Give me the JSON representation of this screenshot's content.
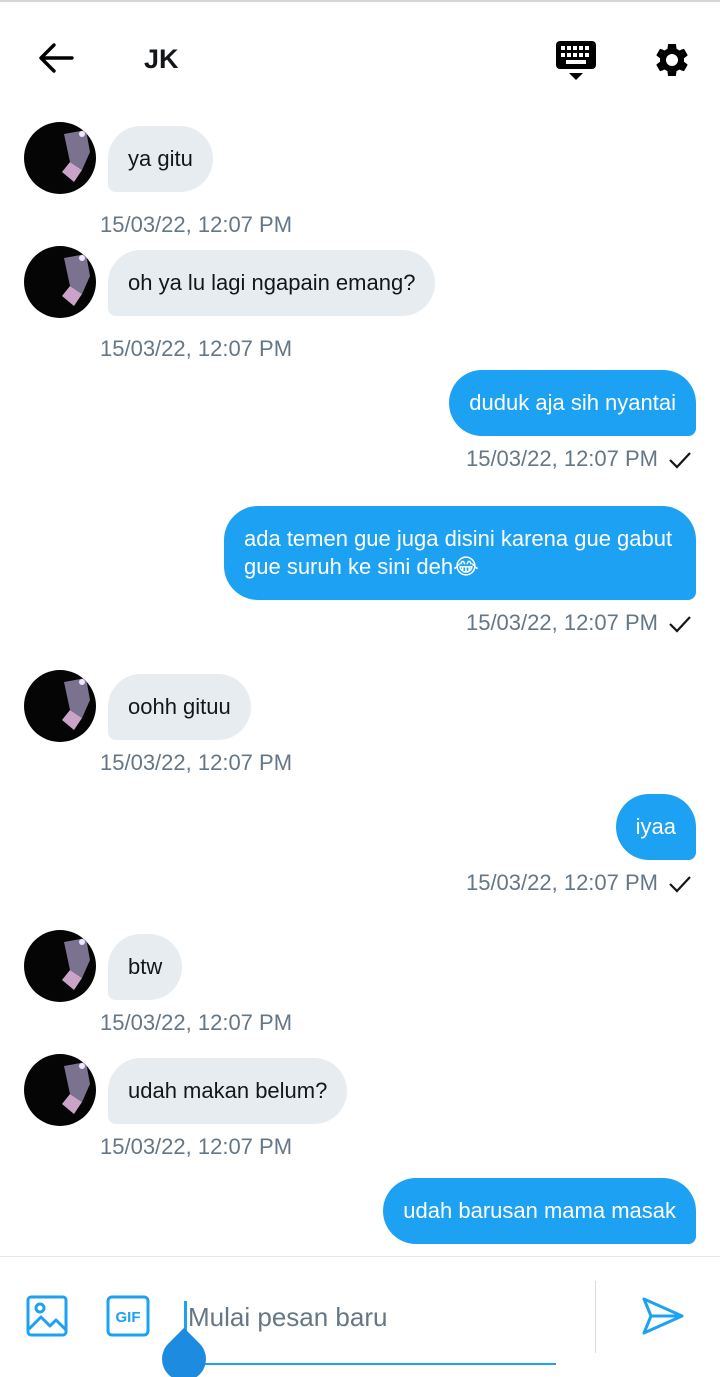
{
  "header": {
    "title": "JK",
    "back_icon": "arrow-left-icon",
    "keyboard_icon": "keyboard-icon",
    "settings_icon": "gear-icon"
  },
  "messages": [
    {
      "direction": "in",
      "text": "ya gitu",
      "time": "15/03/22, 12:07 PM"
    },
    {
      "direction": "in",
      "text": "oh ya lu lagi ngapain emang?",
      "time": "15/03/22, 12:07 PM"
    },
    {
      "direction": "out",
      "text": "duduk aja sih nyantai",
      "time": "15/03/22, 12:07 PM",
      "status": "sent"
    },
    {
      "direction": "out",
      "text": "ada temen gue juga disini karena gue gabut gue suruh ke sini deh😂",
      "time": "15/03/22, 12:07 PM",
      "status": "sent"
    },
    {
      "direction": "in",
      "text": "oohh gituu",
      "time": "15/03/22, 12:07 PM"
    },
    {
      "direction": "out",
      "text": "iyaa",
      "time": "15/03/22, 12:07 PM",
      "status": "sent"
    },
    {
      "direction": "in",
      "text": "btw",
      "time": "15/03/22, 12:07 PM"
    },
    {
      "direction": "in",
      "text": "udah makan belum?",
      "time": "15/03/22, 12:07 PM"
    },
    {
      "direction": "out",
      "text": "udah barusan mama masak",
      "time": ""
    }
  ],
  "composer": {
    "placeholder": "Mulai pesan baru",
    "value": "",
    "gif_label": "GIF"
  },
  "colors": {
    "accent": "#1da1f2",
    "incoming_bubble": "#e6ecf0",
    "timestamp": "#657786"
  }
}
